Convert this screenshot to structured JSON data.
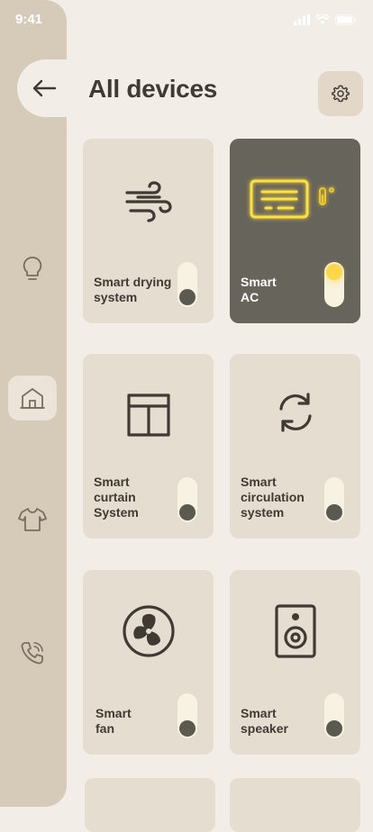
{
  "status": {
    "time": "9:41"
  },
  "header": {
    "title": "All devices"
  },
  "sidebar": {
    "items": [
      {
        "name": "light"
      },
      {
        "name": "home"
      },
      {
        "name": "clothes"
      },
      {
        "name": "phone"
      }
    ]
  },
  "devices": [
    {
      "label": "Smart drying system",
      "on": false
    },
    {
      "label": "Smart AC",
      "on": true
    },
    {
      "label": "Smart curtain System",
      "on": false
    },
    {
      "label": "Smart circulation system",
      "on": false
    },
    {
      "label": "Smart fan",
      "on": false
    },
    {
      "label": "Smart speaker",
      "on": false
    }
  ],
  "colors": {
    "background": "#f2ede6",
    "sidebar": "#d6cbb9",
    "card": "#e6ddd1",
    "active_card": "#67645c",
    "accent": "#ffd84a"
  }
}
